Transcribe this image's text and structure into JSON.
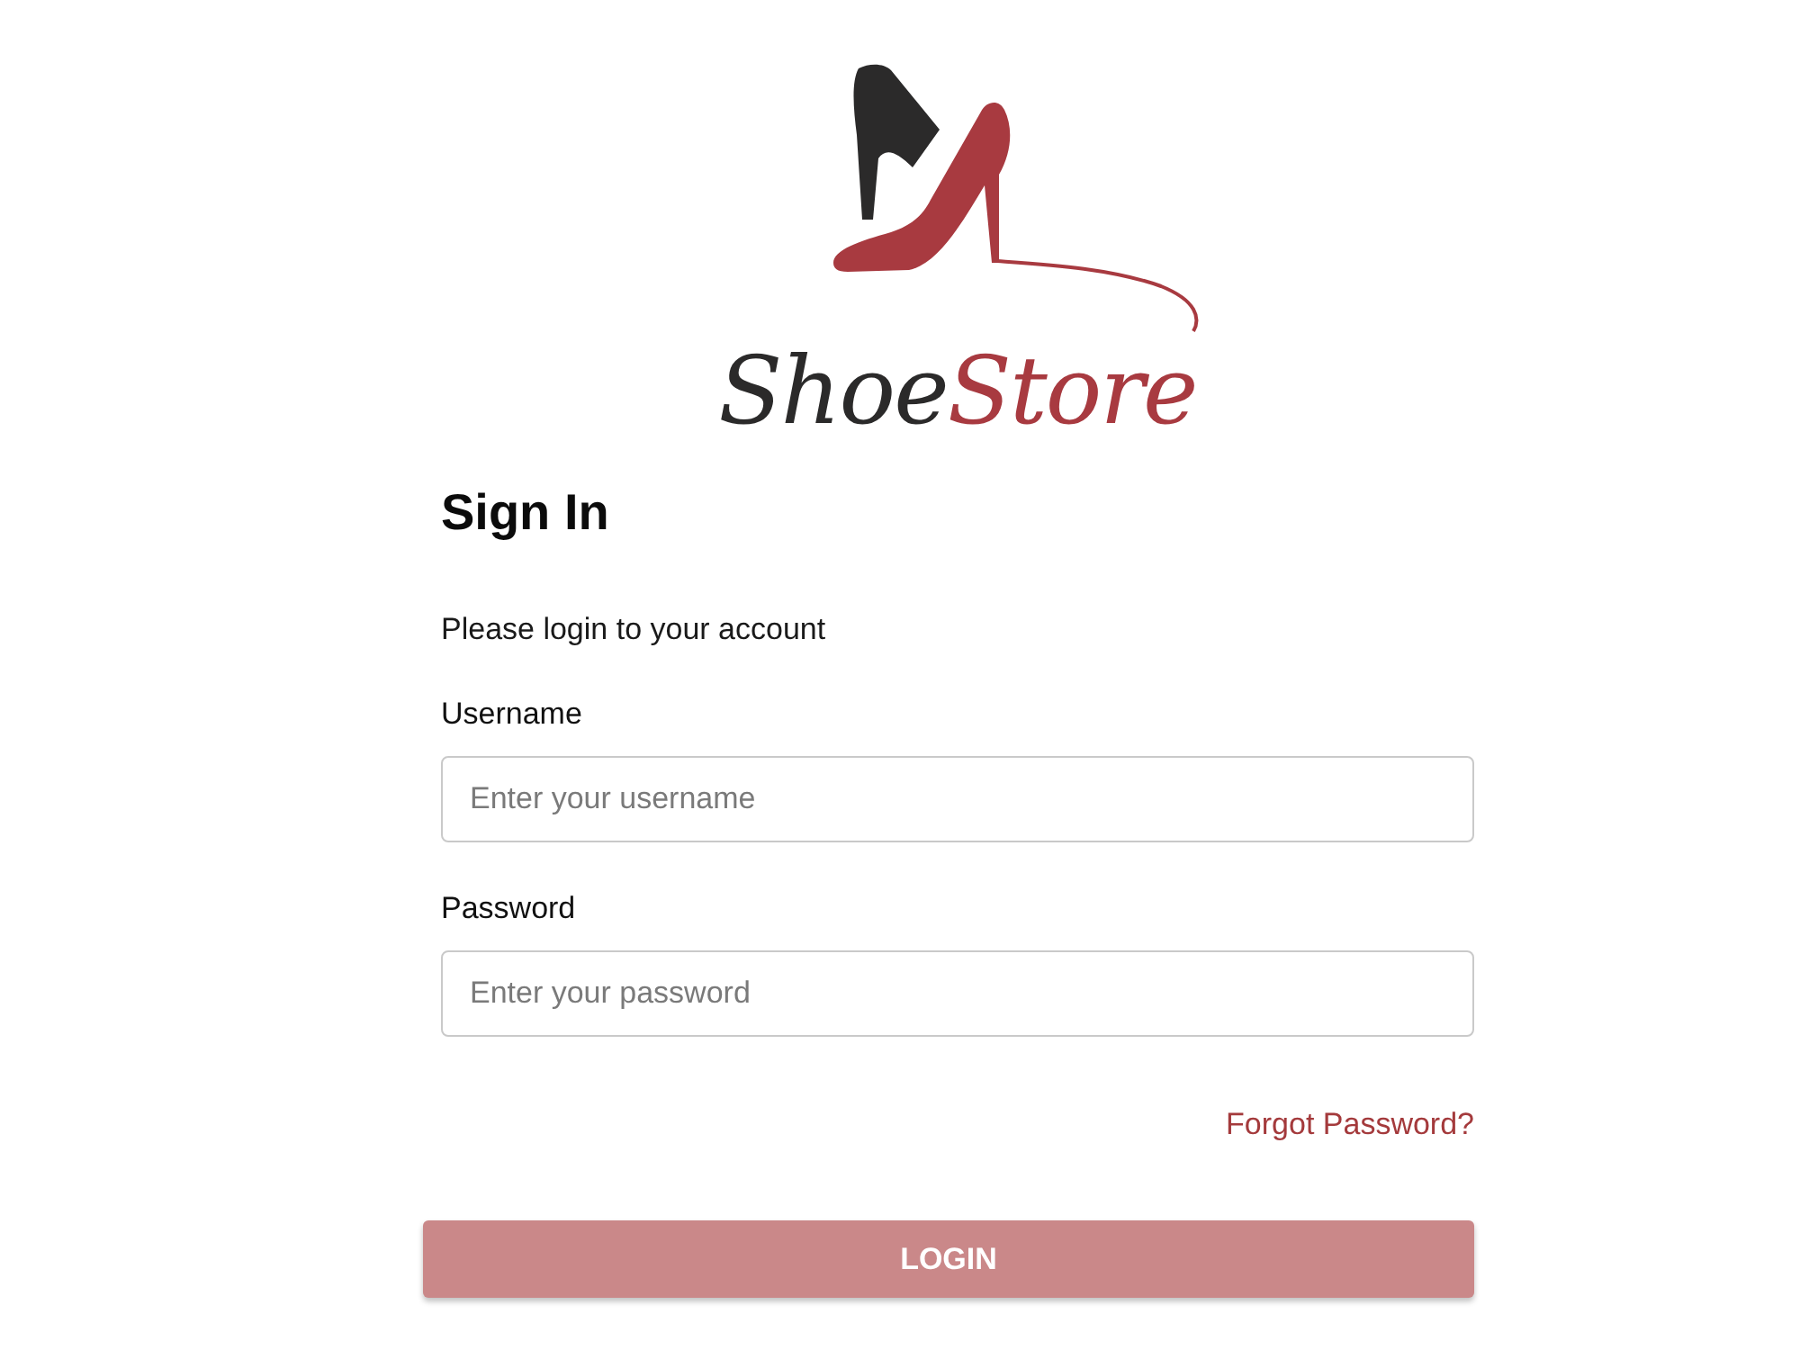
{
  "logo": {
    "parts": [
      {
        "text": "Shoe",
        "color": "#2b2a2a"
      },
      {
        "text": "Store",
        "color": "#a83a40"
      }
    ]
  },
  "heading": "Sign In",
  "subtitle": "Please login to your account",
  "fields": [
    {
      "label": "Username",
      "placeholder": "Enter your username"
    },
    {
      "label": "Password",
      "placeholder": "Enter your password"
    }
  ],
  "forgot_link": "Forgot Password?",
  "login_button": {
    "label": "LOGIN",
    "disabled": true
  }
}
